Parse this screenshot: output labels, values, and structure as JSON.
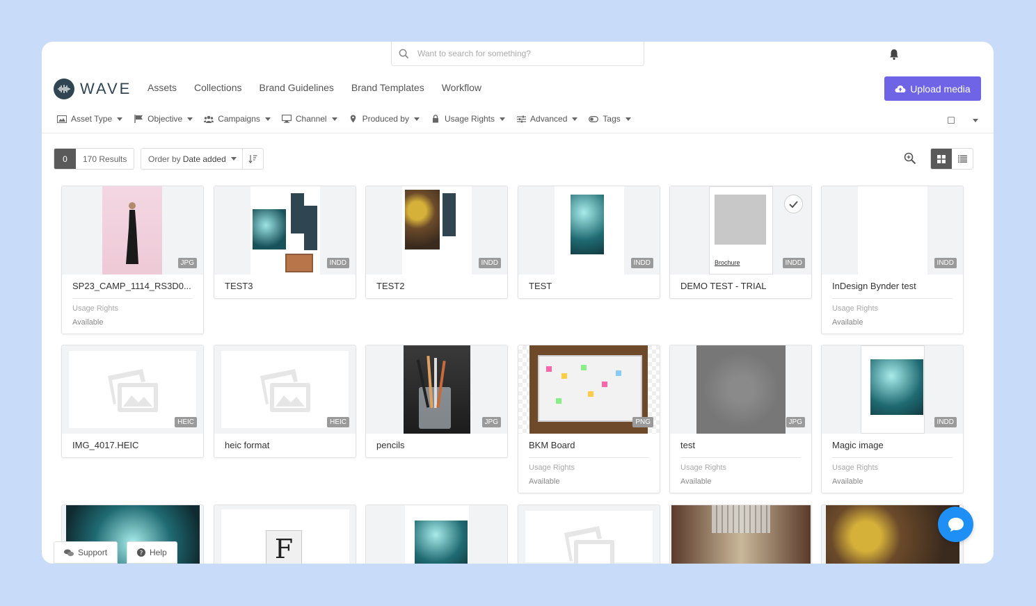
{
  "search": {
    "placeholder": "Want to search for something?"
  },
  "brand": {
    "name": "WAVE"
  },
  "nav": [
    "Assets",
    "Collections",
    "Brand Guidelines",
    "Brand Templates",
    "Workflow"
  ],
  "upload_label": "Upload media",
  "filters": [
    {
      "label": "Asset Type",
      "icon": "image-icon"
    },
    {
      "label": "Objective",
      "icon": "flag-icon"
    },
    {
      "label": "Campaigns",
      "icon": "users-icon"
    },
    {
      "label": "Channel",
      "icon": "monitor-icon"
    },
    {
      "label": "Produced by",
      "icon": "pin-icon"
    },
    {
      "label": "Usage Rights",
      "icon": "lock-icon"
    },
    {
      "label": "Advanced",
      "icon": "sliders-icon"
    },
    {
      "label": "Tags",
      "icon": "toggle-icon"
    }
  ],
  "results": {
    "selected": "0",
    "count_text": "170 Results",
    "order_prefix": "Order by",
    "order_value": "Date added"
  },
  "meta": {
    "label": "Usage Rights",
    "value": "Available"
  },
  "assets": [
    {
      "title": "SP23_CAMP_1114_RS3D0...",
      "type": "JPG",
      "meta": true
    },
    {
      "title": "TEST3",
      "type": "INDD",
      "meta": false
    },
    {
      "title": "TEST2",
      "type": "INDD",
      "meta": false
    },
    {
      "title": "TEST",
      "type": "INDD",
      "meta": false
    },
    {
      "title": "DEMO TEST - TRIAL",
      "type": "INDD",
      "meta": false,
      "thumb_caption": "Brochure"
    },
    {
      "title": "InDesign Bynder test",
      "type": "INDD",
      "meta": true
    },
    {
      "title": "IMG_4017.HEIC",
      "type": "HEIC",
      "meta": false
    },
    {
      "title": "heic format",
      "type": "HEIC",
      "meta": false
    },
    {
      "title": "pencils",
      "type": "JPG",
      "meta": false
    },
    {
      "title": "BKM Board",
      "type": "PNG",
      "meta": true
    },
    {
      "title": "test",
      "type": "JPG",
      "meta": true
    },
    {
      "title": "Magic image",
      "type": "INDD",
      "meta": true
    }
  ],
  "support_label": "Support",
  "help_label": "Help",
  "colors": {
    "accent": "#6f63e6",
    "chat": "#1e90f5",
    "background": "#c8dcfa"
  }
}
